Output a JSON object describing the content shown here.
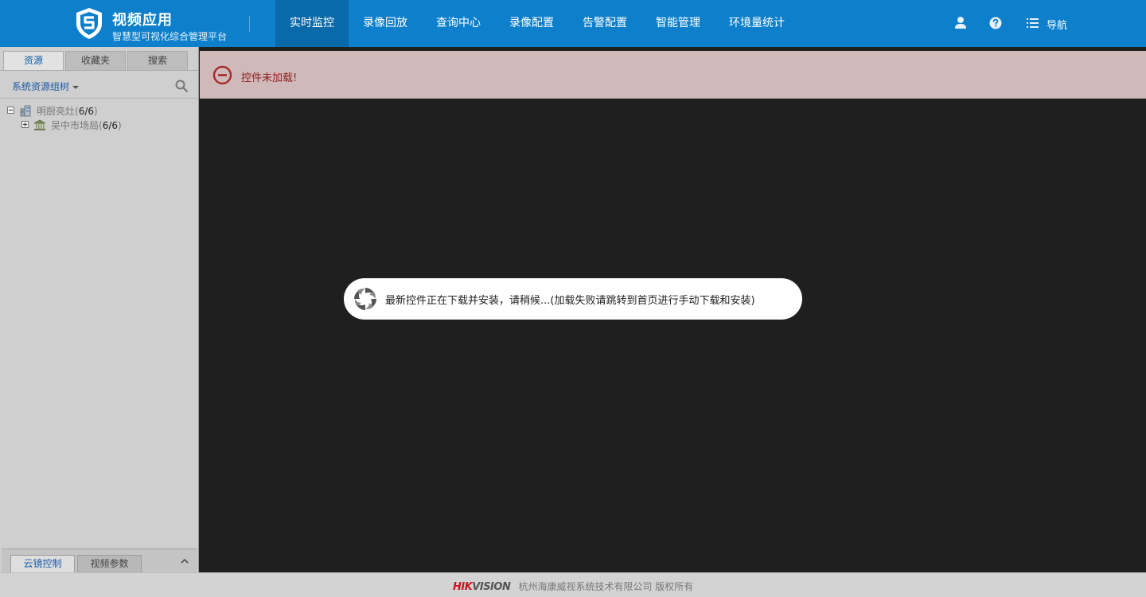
{
  "header": {
    "title": "视频应用",
    "subtitle": "智慧型可视化综合管理平台",
    "nav": [
      {
        "label": "实时监控",
        "active": true
      },
      {
        "label": "录像回放"
      },
      {
        "label": "查询中心"
      },
      {
        "label": "录像配置"
      },
      {
        "label": "告警配置"
      },
      {
        "label": "智能管理"
      },
      {
        "label": "环境量统计"
      }
    ],
    "icons": [
      "user-icon",
      "help-icon",
      "menu-icon"
    ],
    "nav_menu_label": "导航",
    "bg_color": "#0d7fcb"
  },
  "sidebar": {
    "tabs": [
      "资源",
      "收藏夹",
      "搜索"
    ],
    "active_tab": "资源",
    "group_selector": "系统资源组树",
    "tree": [
      {
        "name": "明厨亮灶",
        "count_open": "(",
        "count": "6/6",
        "count_close": ")",
        "expanded": true
      },
      {
        "name": "吴中市场局",
        "count_open": "(",
        "count": "6/6",
        "count_close": ")",
        "expanded": false
      }
    ],
    "bottom_tabs": [
      "云镜控制",
      "视频参数"
    ]
  },
  "alert": {
    "message": "控件未加载!",
    "color": "#8e2020"
  },
  "toast": {
    "message": "最新控件正在下载并安装，请稍候...(加载失败请跳转到首页进行手动下载和安装)"
  },
  "footer": {
    "brand_hik": "HIK",
    "brand_vision": "VISION",
    "copyright": "杭州海康威视系统技术有限公司 版权所有"
  }
}
